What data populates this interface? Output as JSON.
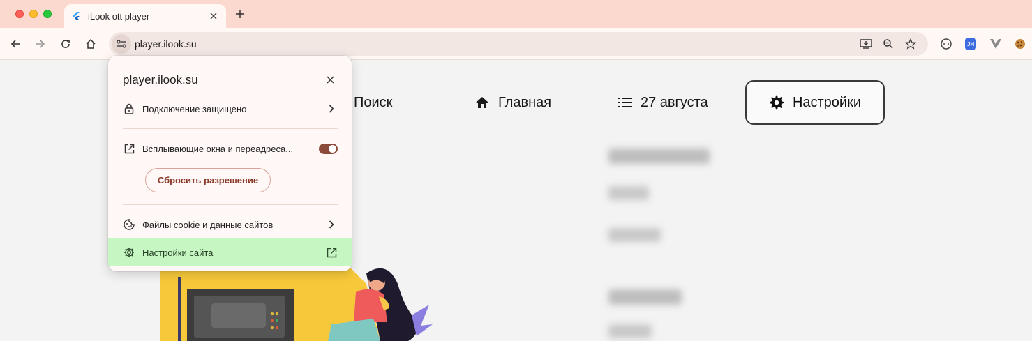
{
  "browser": {
    "tab_title": "iLook ott player",
    "url": "player.ilook.su"
  },
  "page": {
    "nav": {
      "search": "Поиск",
      "home": "Главная",
      "date": "27 августа",
      "settings": "Настройки"
    }
  },
  "popup": {
    "title": "player.ilook.su",
    "connection": "Подключение защищено",
    "popups_redirects": "Всплывающие окна и переадреса...",
    "popups_toggle_on": true,
    "reset_permission": "Сбросить разрешение",
    "cookies": "Файлы cookie и данные сайтов",
    "site_settings": "Настройки сайта"
  },
  "colors": {
    "tabbar": "#fcd9cf",
    "accent": "#8b4a3a",
    "highlight": "#c6f7c3"
  }
}
